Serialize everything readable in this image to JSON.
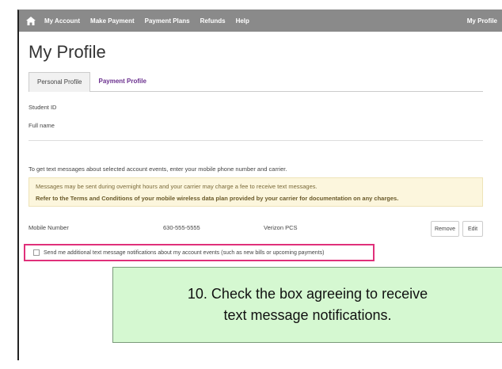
{
  "navbar": {
    "items": [
      "My Account",
      "Make Payment",
      "Payment Plans",
      "Refunds",
      "Help"
    ],
    "right_label": "My Profile"
  },
  "page": {
    "title": "My Profile"
  },
  "tabs": [
    {
      "label": "Personal Profile",
      "active": true
    },
    {
      "label": "Payment Profile",
      "active": false
    }
  ],
  "profile": {
    "student_id_label": "Student ID",
    "full_name_label": "Full name"
  },
  "sms": {
    "intro": "To get text messages about selected account events, enter your mobile phone number and carrier.",
    "notice_line1": "Messages may be sent during overnight hours and your carrier may charge a fee to receive text messages.",
    "notice_line2": "Refer to the Terms and Conditions of your mobile wireless data plan provided by your carrier for documentation on any charges.",
    "mobile_label": "Mobile Number",
    "mobile_value": "630-555-5555",
    "carrier": "Verizon PCS",
    "remove_label": "Remove",
    "edit_label": "Edit",
    "checkbox_label": "Send me additional text message notifications about my account events (such as new bills or upcoming payments)",
    "checkbox_checked": false
  },
  "callout": {
    "line1": "10. Check the box agreeing to receive",
    "line2": "text message notifications."
  },
  "colors": {
    "navbar": "#8a8a8a",
    "tab_link": "#6a2f8e",
    "notice_bg": "#fcf6dd",
    "highlight": "#e0307a",
    "callout_bg": "#d5f8d1"
  }
}
